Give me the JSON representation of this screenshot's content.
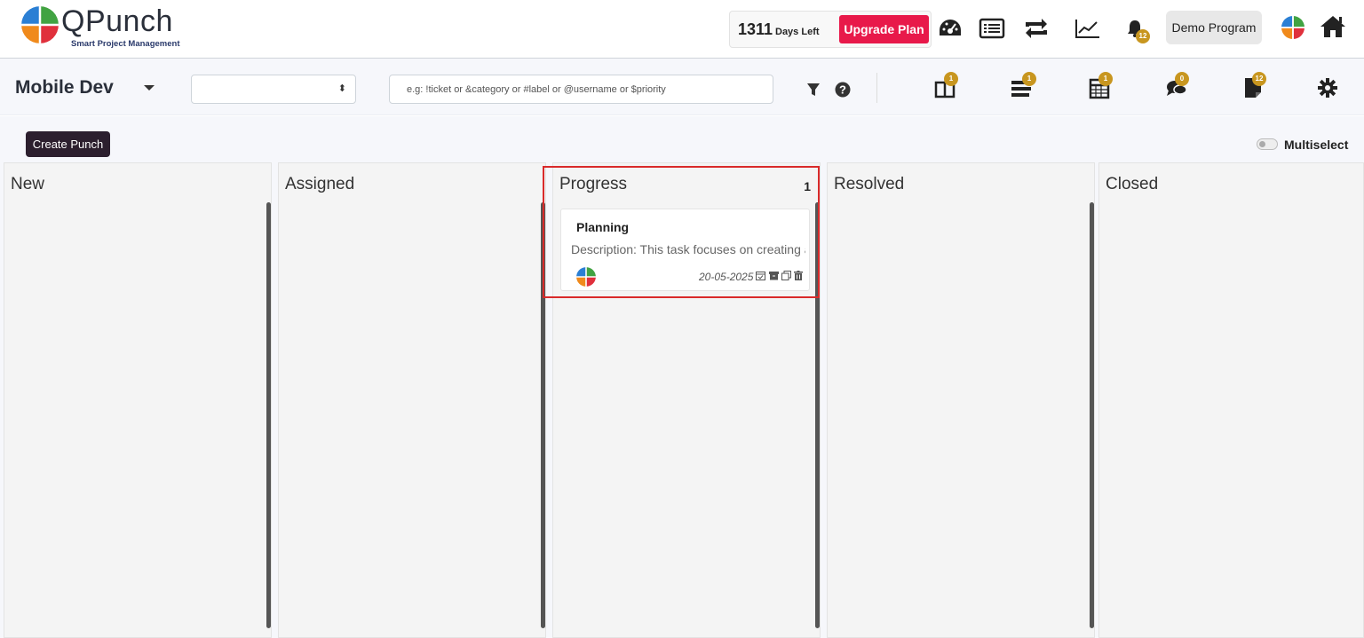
{
  "brand": {
    "name": "QPunch",
    "tagline": "Smart Project Management",
    "colors": {
      "blue": "#2b7fd4",
      "green": "#41a342",
      "orange": "#f08a1c",
      "red": "#e0303c"
    }
  },
  "header": {
    "days_count": "1311",
    "days_label": "Days Left",
    "upgrade_label": "Upgrade Plan",
    "upgrade_color": "#e8194a",
    "icons": [
      "dashboard-icon",
      "list-icon",
      "sync-icon",
      "chart-icon",
      "bell-icon",
      "avatar",
      "home-icon"
    ],
    "notification_count": "12",
    "program_label": "Demo Program"
  },
  "subbar": {
    "project_name": "Mobile Dev",
    "select_value": "",
    "search_placeholder": "e.g: !ticket or &category or #label or @username or $priority",
    "badges": {
      "tickets": "1",
      "backlog": "1",
      "calendar": "1",
      "chat": "0",
      "notes": "12"
    }
  },
  "actions": {
    "create_label": "Create Punch",
    "multiselect_label": "Multiselect",
    "multiselect_on": false
  },
  "board": {
    "columns": [
      {
        "title": "New",
        "count": ""
      },
      {
        "title": "Assigned",
        "count": ""
      },
      {
        "title": "Progress",
        "count": "1"
      },
      {
        "title": "Resolved",
        "count": ""
      },
      {
        "title": "Closed",
        "count": ""
      }
    ],
    "card": {
      "title": "Planning",
      "description": "Description: This task focuses on creating a",
      "date": "20-05-2025"
    }
  }
}
